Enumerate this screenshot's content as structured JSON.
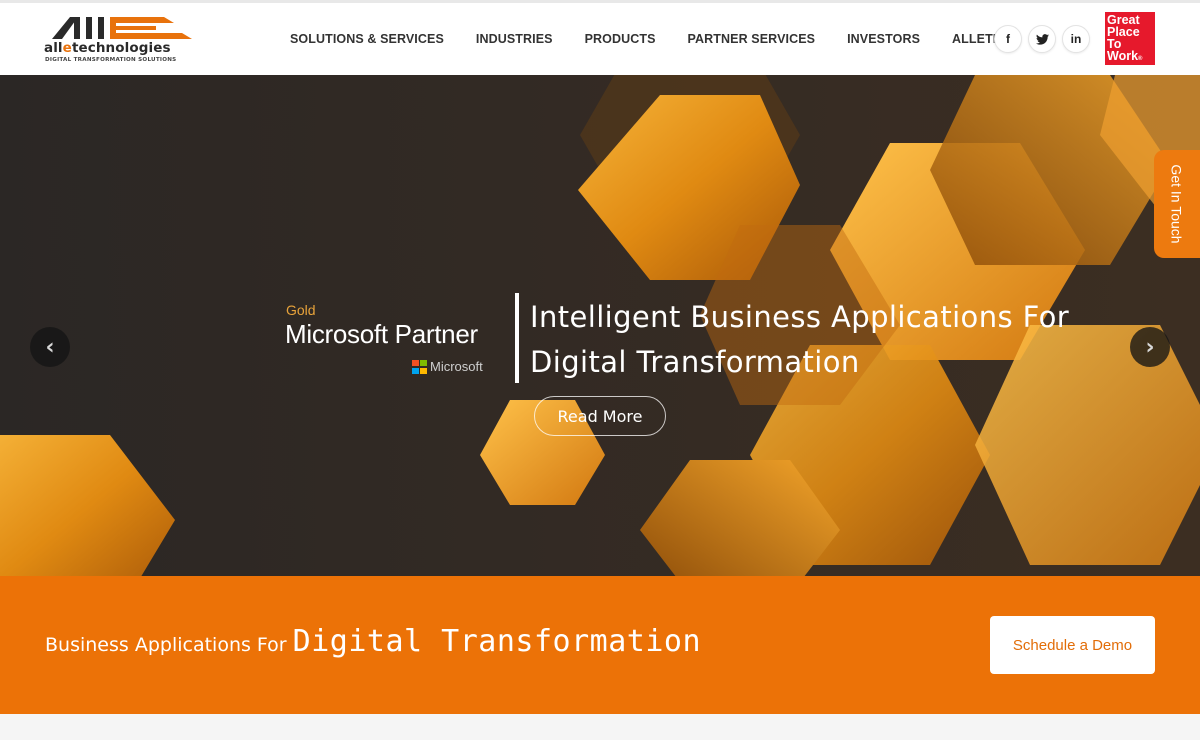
{
  "header": {
    "logo_text_prefix": "all",
    "logo_text_e": "e",
    "logo_text_suffix": "technologies",
    "logo_tagline": "DIGITAL TRANSFORMATION SOLUTIONS",
    "nav": [
      {
        "label": "SOLUTIONS & SERVICES"
      },
      {
        "label": "INDUSTRIES"
      },
      {
        "label": "PRODUCTS"
      },
      {
        "label": "PARTNER SERVICES"
      },
      {
        "label": "INVESTORS"
      },
      {
        "label": "ALLETEC"
      }
    ],
    "socials": [
      {
        "icon": "facebook-icon",
        "glyph": "f"
      },
      {
        "icon": "twitter-icon",
        "glyph": "🐦"
      },
      {
        "icon": "linkedin-icon",
        "glyph": "in"
      }
    ],
    "gptw_lines": [
      "Great",
      "Place",
      "To",
      "Work"
    ],
    "gptw_mark": "®"
  },
  "hero": {
    "partner_level": "Gold",
    "partner_title": "Microsoft Partner",
    "ms_wordmark": "Microsoft",
    "headline": "Intelligent Business Applications For Digital Transformation",
    "read_more": "Read More",
    "prev_arrow": "‹",
    "next_arrow": "›"
  },
  "side_tab": {
    "label": "Get In Touch"
  },
  "band": {
    "text_small": "Business Applications For ",
    "text_large": "Digital Transformation",
    "demo_button": "Schedule a Demo"
  },
  "colors": {
    "accent": "#ec7207",
    "gold_text": "#e8a33a",
    "gptw_red": "#e6192c",
    "hero_bg": "#2a2624"
  }
}
